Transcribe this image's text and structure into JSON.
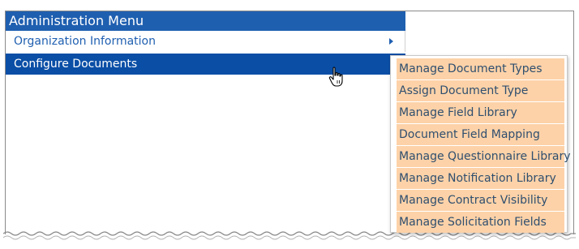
{
  "menu": {
    "header": "Administration Menu",
    "items": [
      {
        "label": "Organization Information",
        "has_submenu": true,
        "active": false
      },
      {
        "label": "Configure Documents",
        "has_submenu": true,
        "active": true
      }
    ]
  },
  "submenu": {
    "items": [
      {
        "label": "Manage Document Types"
      },
      {
        "label": "Assign Document Type"
      },
      {
        "label": "Manage Field Library"
      },
      {
        "label": "Document Field Mapping"
      },
      {
        "label": "Manage Questionnaire Library"
      },
      {
        "label": "Manage Notification Library"
      },
      {
        "label": "Manage Contract Visibility"
      },
      {
        "label": "Manage Solicitation Fields"
      }
    ]
  },
  "colors": {
    "header_bg": "#1f5fb0",
    "active_bg": "#0a4ea6",
    "link_text": "#1f5fb0",
    "submenu_item_bg": "#fdd2a8",
    "submenu_text": "#2f4f6f"
  },
  "icons": {
    "submenu_arrow": "chevron-right-icon",
    "cursor": "hand-pointer-icon"
  }
}
